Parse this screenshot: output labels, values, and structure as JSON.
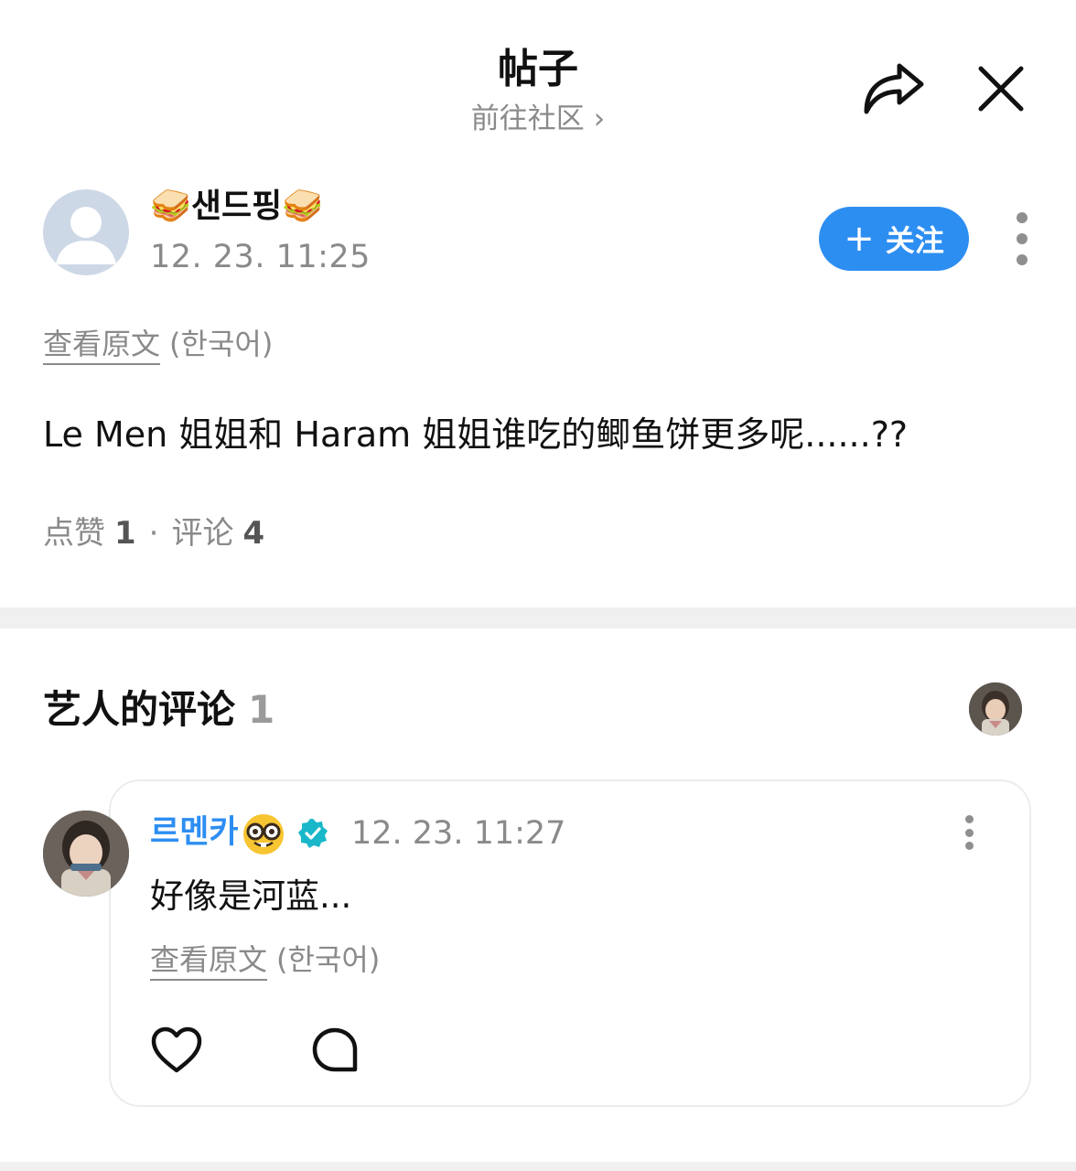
{
  "header": {
    "title": "帖子",
    "subtitle": "前往社区",
    "subtitle_chevron": "›",
    "share_icon": "share-arrow-icon",
    "close_icon": "close-icon"
  },
  "post": {
    "author": {
      "name_prefix_emoji": "🥪",
      "name": "샌드핑",
      "name_suffix_emoji": "🥪",
      "avatar": "default-avatar-icon"
    },
    "time": "12. 23. 11:25",
    "follow_button": {
      "plus": "+",
      "label": "关注"
    },
    "translate": {
      "link": "查看原文",
      "lang": "(한국어)"
    },
    "text": "Le Men 姐姐和 Haram 姐姐谁吃的鲫鱼饼更多呢......??",
    "stats": {
      "likes_label": "点赞",
      "likes": "1",
      "separator": "·",
      "comments_label": "评论",
      "comments": "4"
    }
  },
  "artist_comments": {
    "title": "艺人的评论",
    "count": "1",
    "comment": {
      "author": "르멘카",
      "author_emoji": "nerd-face-emoji",
      "verified_badge": "verified-badge-icon",
      "time": "12. 23. 11:27",
      "text": "好像是河蓝...",
      "translate": {
        "link": "查看原文",
        "lang": "(한국어)"
      },
      "actions": [
        "heart-icon",
        "comment-bubble-icon"
      ]
    }
  },
  "colors": {
    "accent": "#2d8ef2",
    "muted_text": "#8a8a8a",
    "primary_text": "#111111",
    "divider": "#f0f0f1",
    "card_border": "#ececec"
  }
}
